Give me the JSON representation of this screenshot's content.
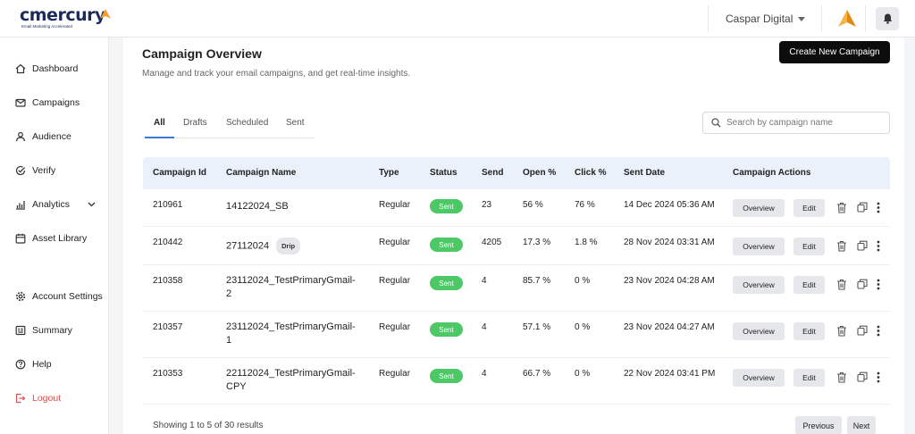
{
  "brand": {
    "name": "cmercury",
    "tagline": "Email Marketing Accelerated"
  },
  "header": {
    "org_name": "Caspar Digital",
    "bell_icon": "bell-icon",
    "brand_icon": "arrow-logo-icon"
  },
  "sidebar": {
    "items": [
      {
        "label": "Dashboard",
        "icon": "home-icon"
      },
      {
        "label": "Campaigns",
        "icon": "mail-icon"
      },
      {
        "label": "Audience",
        "icon": "user-icon"
      },
      {
        "label": "Verify",
        "icon": "check-circle-icon"
      },
      {
        "label": "Analytics",
        "icon": "bar-chart-icon"
      },
      {
        "label": "Asset Library",
        "icon": "calendar-icon"
      },
      {
        "label": "Account Settings",
        "icon": "gear-icon"
      },
      {
        "label": "Summary",
        "icon": "summary-icon"
      },
      {
        "label": "Help",
        "icon": "help-icon"
      },
      {
        "label": "Logout",
        "icon": "logout-icon"
      }
    ]
  },
  "page": {
    "title": "Campaign Overview",
    "subtitle": "Manage and track your email campaigns, and get real-time insights.",
    "create_button": "Create New Campaign",
    "tabs": [
      "All",
      "Drafts",
      "Scheduled",
      "Sent"
    ],
    "active_tab": "All",
    "search_placeholder": "Search by campaign name"
  },
  "table": {
    "headers": [
      "Campaign Id",
      "Campaign Name",
      "Type",
      "Status",
      "Send",
      "Open %",
      "Click %",
      "Sent Date",
      "Campaign Actions"
    ],
    "rows": [
      {
        "id": "210961",
        "name1": "14122024_SB",
        "name2": "",
        "tag": "",
        "type": "Regular",
        "status": "Sent",
        "send": "23",
        "open": "56 %",
        "click": "76 %",
        "date": "14 Dec 2024 05:36 AM"
      },
      {
        "id": "210442",
        "name1": "27112024",
        "name2": "",
        "tag": "Drip",
        "type": "Regular",
        "status": "Sent",
        "send": "4205",
        "open": "17.3 %",
        "click": "1.8 %",
        "date": "28 Nov 2024 03:31 AM"
      },
      {
        "id": "210358",
        "name1": "23112024_TestPrimaryGmail-",
        "name2": "2",
        "tag": "",
        "type": "Regular",
        "status": "Sent",
        "send": "4",
        "open": "85.7 %",
        "click": "0 %",
        "date": "23 Nov 2024 04:28 AM"
      },
      {
        "id": "210357",
        "name1": "23112024_TestPrimaryGmail-",
        "name2": "1",
        "tag": "",
        "type": "Regular",
        "status": "Sent",
        "send": "4",
        "open": "57.1 %",
        "click": "0 %",
        "date": "23 Nov 2024 04:27 AM"
      },
      {
        "id": "210353",
        "name1": "22112024_TestPrimaryGmail-",
        "name2": "CPY",
        "tag": "",
        "type": "Regular",
        "status": "Sent",
        "send": "4",
        "open": "66.7 %",
        "click": "0 %",
        "date": "22 Nov 2024 03:41 PM"
      }
    ],
    "overview_label": "Overview",
    "edit_label": "Edit"
  },
  "pagination": {
    "summary": "Showing 1 to 5 of 30 results",
    "previous": "Previous",
    "next": "Next"
  },
  "colors": {
    "sent_badge": "#4cc865",
    "tab_accent": "#3c78d8",
    "header_row": "#eaf1fb",
    "logout": "#d9534f",
    "brand_orange": "#f0a030"
  }
}
